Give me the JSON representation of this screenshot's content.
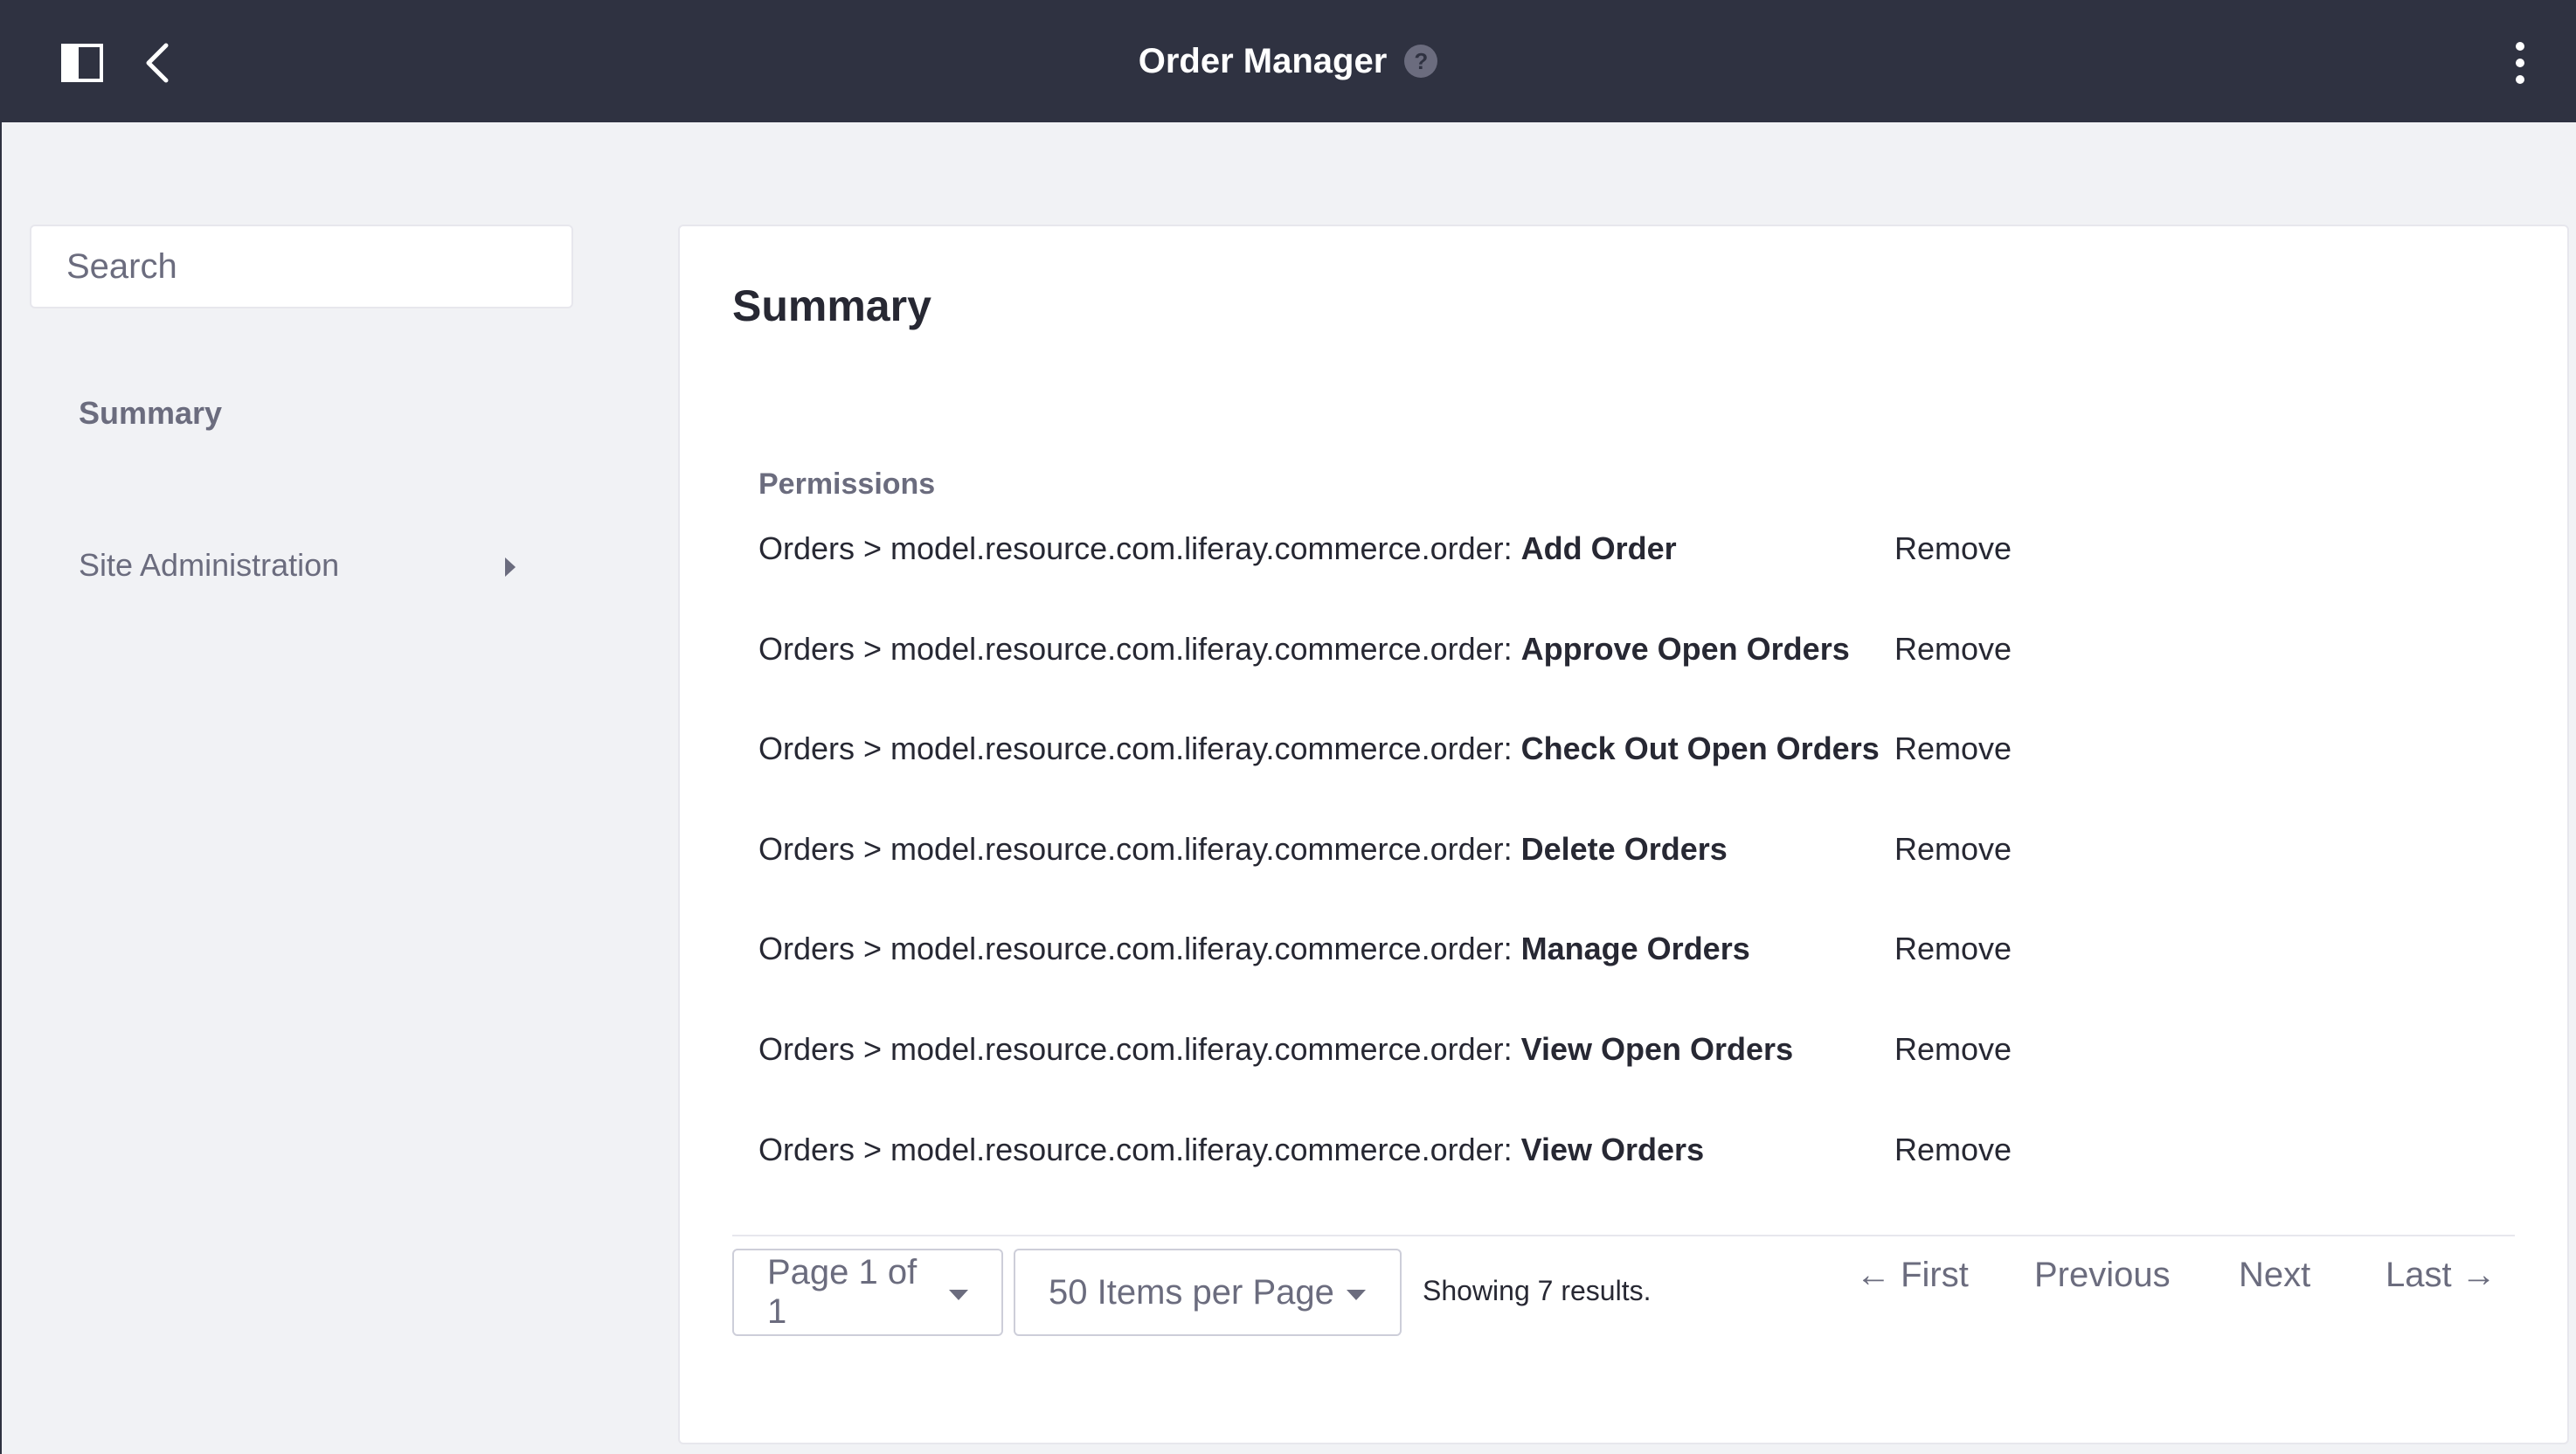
{
  "header": {
    "title": "Order Manager",
    "help_glyph": "?",
    "icons": [
      "sidebar-panel-icon",
      "chevron-left-icon",
      "help-icon",
      "kebab-menu-icon"
    ]
  },
  "sidebar": {
    "search_placeholder": "Search",
    "items": [
      {
        "label": "Summary"
      },
      {
        "label": "Site Administration"
      }
    ]
  },
  "main": {
    "title": "Summary",
    "permissions_header": "Permissions",
    "permissions": [
      {
        "prefix": "Orders > model.resource.com.liferay.commerce.order:",
        "name": "Add Order",
        "action": "Remove"
      },
      {
        "prefix": "Orders > model.resource.com.liferay.commerce.order:",
        "name": "Approve Open Orders",
        "action": "Remove"
      },
      {
        "prefix": "Orders > model.resource.com.liferay.commerce.order:",
        "name": "Check Out Open Orders",
        "action": "Remove"
      },
      {
        "prefix": "Orders > model.resource.com.liferay.commerce.order:",
        "name": "Delete Orders",
        "action": "Remove"
      },
      {
        "prefix": "Orders > model.resource.com.liferay.commerce.order:",
        "name": "Manage Orders",
        "action": "Remove"
      },
      {
        "prefix": "Orders > model.resource.com.liferay.commerce.order:",
        "name": "View Open Orders",
        "action": "Remove"
      },
      {
        "prefix": "Orders > model.resource.com.liferay.commerce.order:",
        "name": "View Orders",
        "action": "Remove"
      }
    ],
    "pagination": {
      "page_label": "Page 1 of 1",
      "items_label": "50 Items per Page",
      "showing": "Showing 7 results.",
      "first": "← First",
      "previous": "Previous",
      "next": "Next",
      "last": "Last →"
    }
  },
  "colors": {
    "topbar": "#2f3241",
    "background": "#f1f2f5",
    "text": "#272833",
    "muted": "#6b6c7e"
  }
}
